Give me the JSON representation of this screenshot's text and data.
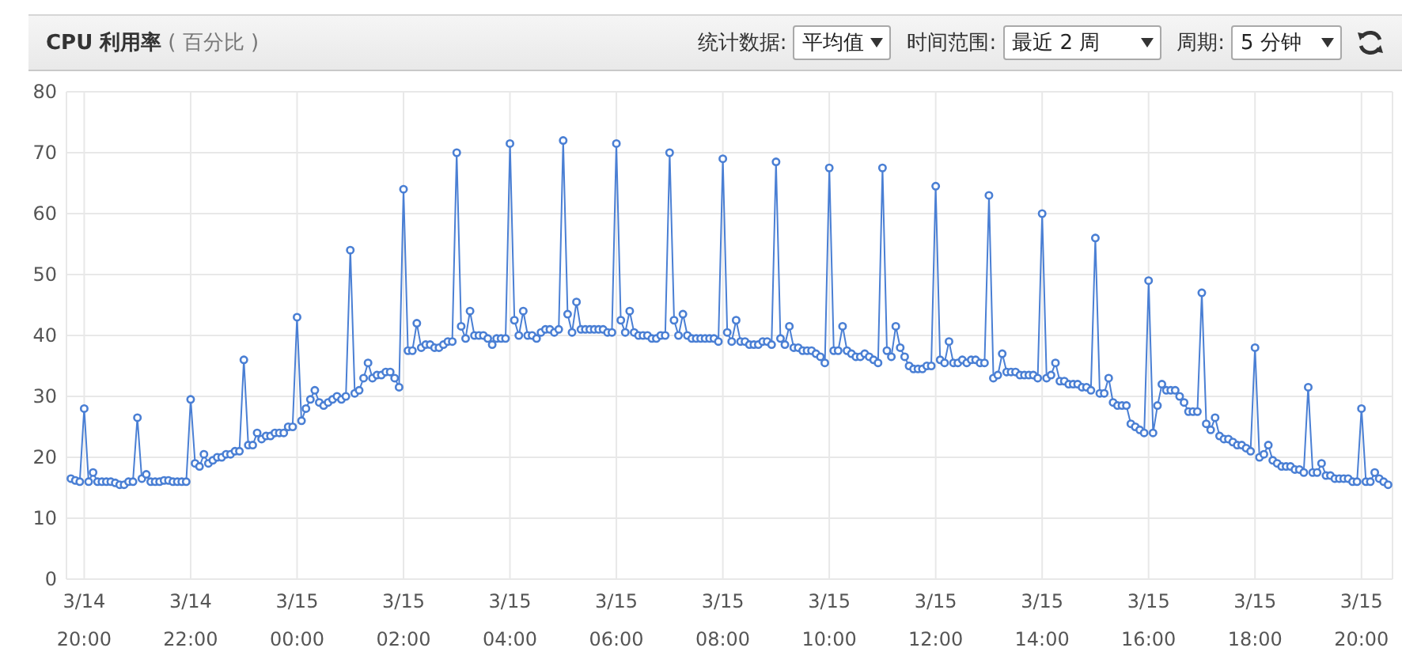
{
  "header": {
    "title": "CPU 利用率",
    "unit": "( 百分比 )",
    "controls": [
      {
        "label": "统计数据:",
        "value": "平均值"
      },
      {
        "label": "时间范围:",
        "value": "最近 2 周"
      },
      {
        "label": "周期:",
        "value": "5 分钟"
      }
    ]
  },
  "chart": {
    "chart_data": {
      "type": "line",
      "grid": true,
      "ylim": [
        0,
        80
      ],
      "yticks": [
        0,
        10,
        20,
        30,
        40,
        50,
        60,
        70,
        80
      ],
      "categories": [
        null,
        null,
        null,
        "3/14\n20:00",
        null,
        null,
        null,
        null,
        null,
        null,
        null,
        null,
        null,
        null,
        null,
        null,
        null,
        null,
        null,
        null,
        null,
        null,
        null,
        null,
        null,
        null,
        null,
        "3/14\n22:00",
        null,
        null,
        null,
        null,
        null,
        null,
        null,
        null,
        null,
        null,
        null,
        null,
        null,
        null,
        null,
        null,
        null,
        null,
        null,
        null,
        null,
        null,
        null,
        "3/15\n00:00",
        null,
        null,
        null,
        null,
        null,
        null,
        null,
        null,
        null,
        null,
        null,
        null,
        null,
        null,
        null,
        null,
        null,
        null,
        null,
        null,
        null,
        null,
        null,
        "3/15\n02:00",
        null,
        null,
        null,
        null,
        null,
        null,
        null,
        null,
        null,
        null,
        null,
        null,
        null,
        null,
        null,
        null,
        null,
        null,
        null,
        null,
        null,
        null,
        null,
        "3/15\n04:00",
        null,
        null,
        null,
        null,
        null,
        null,
        null,
        null,
        null,
        null,
        null,
        null,
        null,
        null,
        null,
        null,
        null,
        null,
        null,
        null,
        null,
        null,
        null,
        "3/15\n06:00",
        null,
        null,
        null,
        null,
        null,
        null,
        null,
        null,
        null,
        null,
        null,
        null,
        null,
        null,
        null,
        null,
        null,
        null,
        null,
        null,
        null,
        null,
        null,
        "3/15\n08:00",
        null,
        null,
        null,
        null,
        null,
        null,
        null,
        null,
        null,
        null,
        null,
        null,
        null,
        null,
        null,
        null,
        null,
        null,
        null,
        null,
        null,
        null,
        null,
        "3/15\n10:00",
        null,
        null,
        null,
        null,
        null,
        null,
        null,
        null,
        null,
        null,
        null,
        null,
        null,
        null,
        null,
        null,
        null,
        null,
        null,
        null,
        null,
        null,
        null,
        "3/15\n12:00",
        null,
        null,
        null,
        null,
        null,
        null,
        null,
        null,
        null,
        null,
        null,
        null,
        null,
        null,
        null,
        null,
        null,
        null,
        null,
        null,
        null,
        null,
        null,
        "3/15\n14:00",
        null,
        null,
        null,
        null,
        null,
        null,
        null,
        null,
        null,
        null,
        null,
        null,
        null,
        null,
        null,
        null,
        null,
        null,
        null,
        null,
        null,
        null,
        null,
        "3/15\n16:00",
        null,
        null,
        null,
        null,
        null,
        null,
        null,
        null,
        null,
        null,
        null,
        null,
        null,
        null,
        null,
        null,
        null,
        null,
        null,
        null,
        null,
        null,
        null,
        "3/15\n18:00",
        null,
        null,
        null,
        null,
        null,
        null,
        null,
        null,
        null,
        null,
        null,
        null,
        null,
        null,
        null,
        null,
        null,
        null,
        null,
        null,
        null,
        null,
        null,
        "3/15\n20:00",
        null,
        null,
        null,
        null,
        null,
        null
      ],
      "series": [
        {
          "color": "#4a7fd4",
          "marker": "circle",
          "values": [
            16.5,
            16.2,
            16,
            28,
            16,
            17.5,
            16,
            16,
            16,
            16,
            15.8,
            15.5,
            15.5,
            16,
            16,
            26.5,
            16.5,
            17.2,
            16,
            16,
            16,
            16.2,
            16.2,
            16,
            16,
            16,
            16,
            29.5,
            19,
            18.5,
            20.5,
            19,
            19.5,
            20,
            20,
            20.5,
            20.5,
            21,
            21,
            36,
            22,
            22,
            24,
            23,
            23.5,
            23.5,
            24,
            24,
            24,
            25,
            25,
            43,
            26,
            28,
            29.5,
            31,
            29,
            28.5,
            29,
            29.5,
            30,
            29.5,
            30,
            54,
            30.5,
            31,
            33,
            35.5,
            33,
            33.5,
            33.5,
            34,
            34,
            33,
            31.5,
            64,
            37.5,
            37.5,
            42,
            38,
            38.5,
            38.5,
            38,
            38,
            38.5,
            39,
            39,
            70,
            41.5,
            39.5,
            44,
            40,
            40,
            40,
            39.5,
            38.5,
            39.5,
            39.5,
            39.5,
            71.5,
            42.5,
            40,
            44,
            40,
            40,
            39.5,
            40.5,
            41,
            41,
            40.5,
            41,
            72,
            43.5,
            40.5,
            45.5,
            41,
            41,
            41,
            41,
            41,
            41,
            40.5,
            40.5,
            71.5,
            42.5,
            40.5,
            44,
            40.5,
            40,
            40,
            40,
            39.5,
            39.5,
            40,
            40,
            70,
            42.5,
            40,
            43.5,
            40,
            39.5,
            39.5,
            39.5,
            39.5,
            39.5,
            39.5,
            39,
            69,
            40.5,
            39,
            42.5,
            39,
            39,
            38.5,
            38.5,
            38.5,
            39,
            39,
            38.5,
            68.5,
            39.5,
            38.5,
            41.5,
            38,
            38,
            37.5,
            37.5,
            37.5,
            37,
            36.5,
            35.5,
            67.5,
            37.5,
            37.5,
            41.5,
            37.5,
            37,
            36.5,
            36.5,
            37,
            36.5,
            36,
            35.5,
            67.5,
            37.5,
            36.5,
            41.5,
            38,
            36.5,
            35,
            34.5,
            34.5,
            34.5,
            35,
            35,
            64.5,
            36,
            35.5,
            39,
            35.5,
            35.5,
            36,
            35.5,
            36,
            36,
            35.5,
            35.5,
            63,
            33,
            33.5,
            37,
            34,
            34,
            34,
            33.5,
            33.5,
            33.5,
            33.5,
            33,
            60,
            33,
            33.5,
            35.5,
            32.5,
            32.5,
            32,
            32,
            32,
            31.5,
            31.5,
            31,
            56,
            30.5,
            30.5,
            33,
            29,
            28.5,
            28.5,
            28.5,
            25.5,
            25,
            24.5,
            24,
            49,
            24,
            28.5,
            32,
            31,
            31,
            31,
            30,
            29,
            27.5,
            27.5,
            27.5,
            47,
            25.5,
            24.5,
            26.5,
            23.5,
            23,
            23,
            22.5,
            22,
            22,
            21.5,
            21,
            38,
            20,
            20.5,
            22,
            19.5,
            19,
            18.5,
            18.5,
            18.5,
            18,
            18,
            17.5,
            31.5,
            17.5,
            17.5,
            19,
            17,
            17,
            16.5,
            16.5,
            16.5,
            16.5,
            16,
            16,
            28,
            16,
            16,
            17.5,
            16.5,
            16,
            15.5
          ]
        }
      ]
    }
  }
}
